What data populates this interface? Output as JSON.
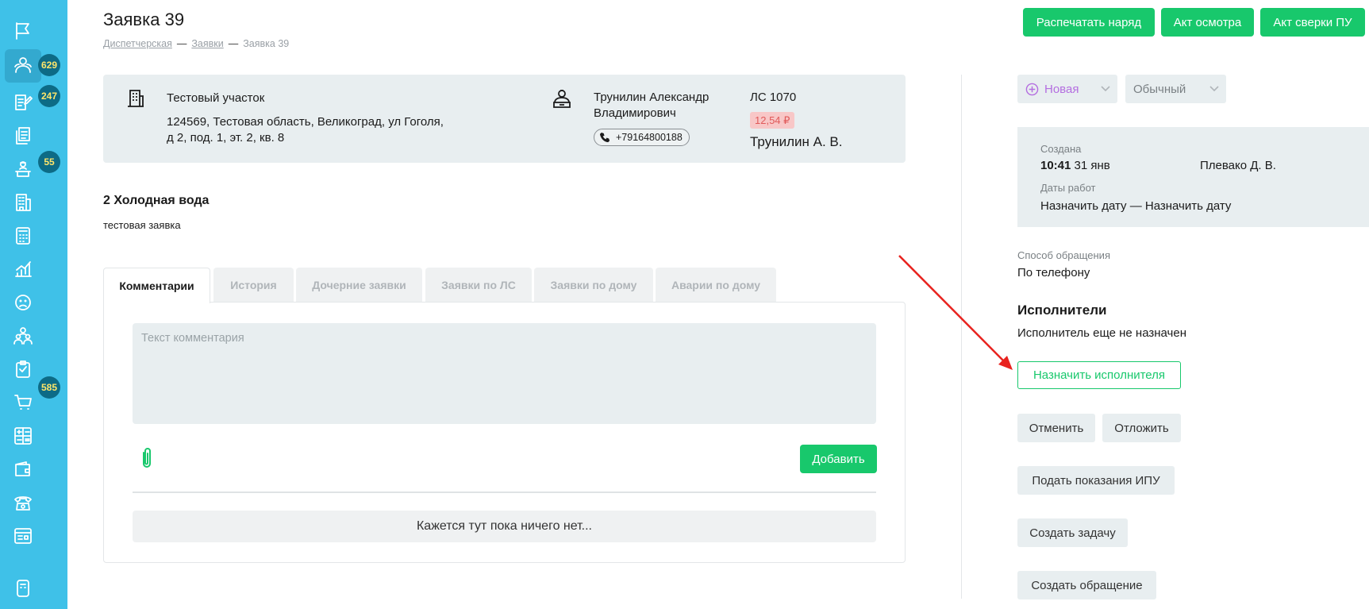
{
  "sidebar": {
    "badges": {
      "clients": "629",
      "requests": "247",
      "workers": "55",
      "tasks": "585"
    }
  },
  "page": {
    "title": "Заявка 39",
    "breadcrumb": {
      "dispatch": "Диспетчерская",
      "sep": "—",
      "requests": "Заявки",
      "current": "Заявка 39"
    }
  },
  "header_buttons": {
    "print": "Распечатать наряд",
    "inspection": "Акт осмотра",
    "reconciliation": "Акт сверки ПУ"
  },
  "info": {
    "site_name": "Тестовый участок",
    "address_line1": "124569, Тестовая область, Великоград, ул Гоголя,",
    "address_line2": "д 2, под. 1, эт. 2, кв. 8",
    "person_line1": "Трунилин Александр",
    "person_line2": "Владимирович",
    "phone": "+79164800188",
    "account": "ЛС 1070",
    "debt": "12,54 ₽",
    "short_name": "Трунилин А. В."
  },
  "request": {
    "title": "2 Холодная вода",
    "description": "тестовая заявка"
  },
  "tabs": [
    "Комментарии",
    "История",
    "Дочерние заявки",
    "Заявки по ЛС",
    "Заявки по дому",
    "Аварии по дому"
  ],
  "comments": {
    "placeholder": "Текст комментария",
    "add_label": "Добавить",
    "empty_text": "Кажется тут пока ничего нет..."
  },
  "right": {
    "status": "Новая",
    "priority": "Обычный",
    "created_label": "Создана",
    "created_time": "10:41",
    "created_date": "31 янв",
    "created_by": "Плевако Д. В.",
    "work_dates_label": "Даты работ",
    "work_dates_value": "Назначить дату — Назначить дату",
    "contact_method_label": "Способ обращения",
    "contact_method_value": "По телефону",
    "executors_title": "Исполнители",
    "executors_empty": "Исполнитель еще не назначен",
    "assign_label": "Назначить исполнителя",
    "cancel_label": "Отменить",
    "postpone_label": "Отложить",
    "meter_label": "Подать показания ИПУ",
    "create_task_label": "Создать задачу",
    "create_appeal_label": "Создать обращение"
  },
  "colors": {
    "sidebar": "#3fc1e8",
    "accent_green": "#18c86c",
    "panel_bg": "#e8eef0",
    "badge_bg": "#0d6b86",
    "badge_text": "#ffe66a",
    "annotation_arrow": "#e8231f",
    "status_purple": "#b46ee0"
  }
}
